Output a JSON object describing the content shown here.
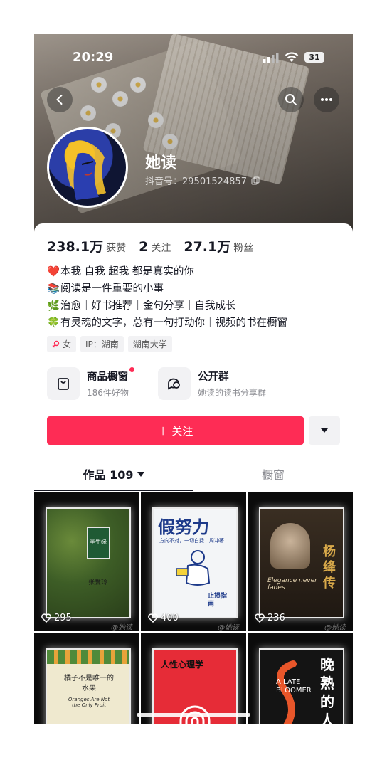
{
  "status": {
    "time": "20:29",
    "battery": "31"
  },
  "profile": {
    "name": "她读",
    "uid_label": "抖音号：29501524857"
  },
  "stats": [
    {
      "num": "238.1万",
      "label": "获赞"
    },
    {
      "num": "2",
      "label": "关注"
    },
    {
      "num": "27.1万",
      "label": "粉丝"
    }
  ],
  "bio": [
    {
      "icon": "❤️",
      "text": "本我 自我 超我 都是真实的你"
    },
    {
      "icon": "📚",
      "text": "阅读是一件重要的小事"
    },
    {
      "icon": "🌿",
      "text": "治愈｜好书推荐｜金句分享｜自我成长"
    },
    {
      "icon": "🍀",
      "text": "有灵魂的文字，总有一句打动你｜视频的书在橱窗"
    }
  ],
  "tags": {
    "gender": "女",
    "ip": "IP：湖南",
    "school": "湖南大学"
  },
  "features": {
    "shop": {
      "title": "商品橱窗",
      "sub": "186件好物"
    },
    "group": {
      "title": "公开群",
      "sub": "她读的读书分享群"
    }
  },
  "actions": {
    "follow": "＋ 关注"
  },
  "tabs": {
    "works": "作品 109",
    "window": "橱窗"
  },
  "grid": [
    {
      "likes": "295",
      "watermark": "@她读",
      "cover_text": "半生缘"
    },
    {
      "likes": "400",
      "watermark": "@她读",
      "cover_text": "假努力"
    },
    {
      "likes": "236",
      "watermark": "@她读",
      "cover_text": "杨绛传"
    },
    {
      "likes": "",
      "watermark": "",
      "cover_text": "橘子不是唯一的水果"
    },
    {
      "likes": "",
      "watermark": "",
      "cover_text": "人性心理学"
    },
    {
      "likes": "",
      "watermark": "",
      "cover_text": "晚熟的人"
    }
  ],
  "grid_extra": {
    "c1_sub": "张爱玲",
    "c2_tag": "方向不对，一切白费",
    "c2_tag2": "周冲著",
    "c2_bottom": "止损指南",
    "c3_en": "Elegance never fades",
    "c4_en": "Oranges Are Not the Only Fruit",
    "c6_en": "A LATE BLOOMER"
  },
  "colors": {
    "accent": "#fe2c55",
    "text": "#161823",
    "muted": "#8a8b91"
  }
}
